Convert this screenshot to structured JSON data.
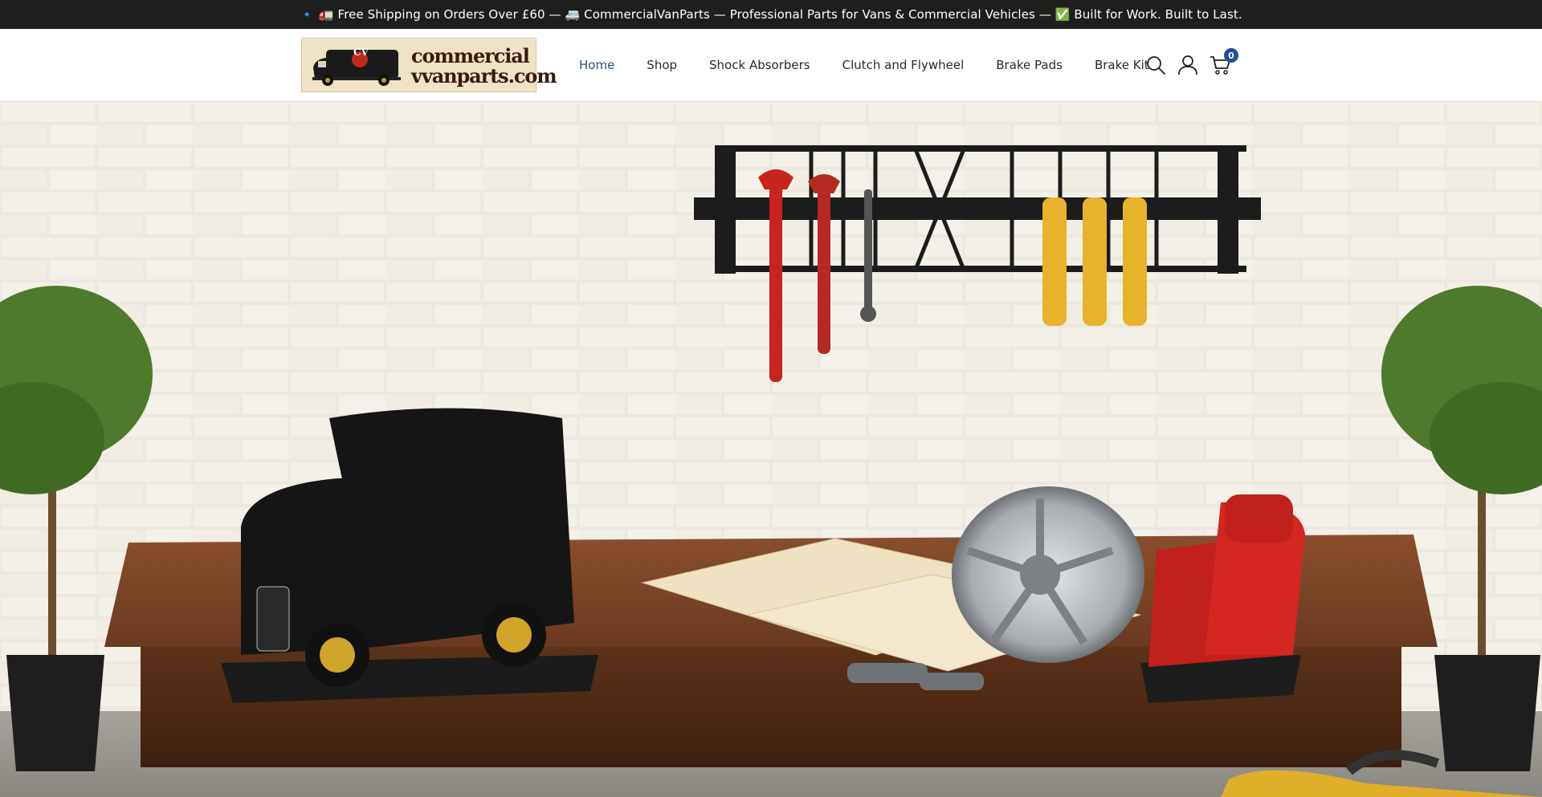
{
  "announcement": {
    "text": "🔹 🚛 Free Shipping on Orders Over £60 — 🚐 CommercialVanParts — Professional Parts for Vans & Commercial Vehicles — ✅ Built for Work. Built to Last."
  },
  "header": {
    "logo": {
      "badge_text": "CV",
      "line1": "commercial",
      "line2": "vvanparts.com"
    },
    "nav": [
      {
        "label": "Home",
        "active": true
      },
      {
        "label": "Shop"
      },
      {
        "label": "Shock Absorbers"
      },
      {
        "label": "Clutch and Flywheel"
      },
      {
        "label": "Brake Pads"
      },
      {
        "label": "Brake Kit"
      }
    ],
    "icons": {
      "search": "search-icon",
      "account": "user-icon",
      "cart": "cart-icon"
    },
    "cart_count": "0",
    "colors": {
      "announcement_bg": "#1e1f1d",
      "nav_active": "#2a4d8a",
      "cart_badge": "#1f4e9c"
    }
  },
  "hero": {
    "image_subject": "workshop-display"
  }
}
